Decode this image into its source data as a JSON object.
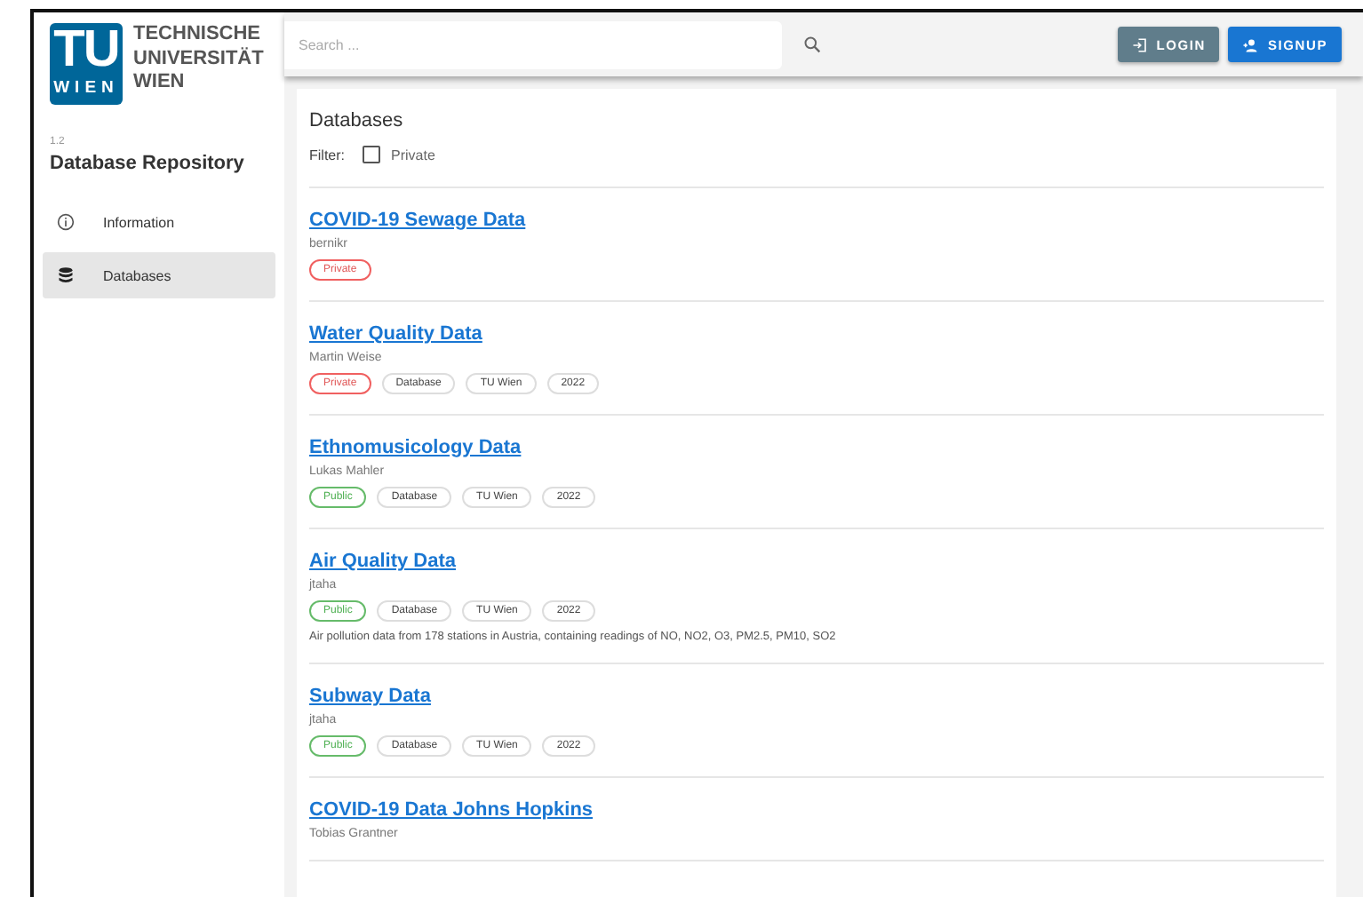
{
  "logo": {
    "mark": "TU",
    "mark_sub": "WIEN",
    "lines": [
      "TECHNISCHE",
      "UNIVERSITÄT",
      "WIEN"
    ]
  },
  "version": "1.2",
  "app_title": "Database Repository",
  "sidebar": {
    "items": [
      {
        "label": "Information",
        "kind": "info",
        "selected": false
      },
      {
        "label": "Databases",
        "kind": "database",
        "selected": true
      }
    ]
  },
  "search": {
    "placeholder": "Search ..."
  },
  "buttons": [
    {
      "label": "LOGIN",
      "kind": "login"
    },
    {
      "label": "SIGNUP",
      "kind": "signup"
    }
  ],
  "page_title": "Databases",
  "filter": {
    "label": "Filter:",
    "option": "Private",
    "checked": false
  },
  "databases": [
    {
      "title": "COVID-19 Sewage Data",
      "author": "bernikr",
      "tags": [
        {
          "label": "Private",
          "kind": "private"
        }
      ]
    },
    {
      "title": "Water Quality Data",
      "author": "Martin Weise",
      "tags": [
        {
          "label": "Private",
          "kind": "private"
        },
        {
          "label": "Database",
          "kind": "plain"
        },
        {
          "label": "TU Wien",
          "kind": "plain"
        },
        {
          "label": "2022",
          "kind": "plain"
        }
      ]
    },
    {
      "title": "Ethnomusicology Data",
      "author": "Lukas Mahler",
      "tags": [
        {
          "label": "Public",
          "kind": "public"
        },
        {
          "label": "Database",
          "kind": "plain"
        },
        {
          "label": "TU Wien",
          "kind": "plain"
        },
        {
          "label": "2022",
          "kind": "plain"
        }
      ]
    },
    {
      "title": "Air Quality Data",
      "author": "jtaha",
      "tags": [
        {
          "label": "Public",
          "kind": "public"
        },
        {
          "label": "Database",
          "kind": "plain"
        },
        {
          "label": "TU Wien",
          "kind": "plain"
        },
        {
          "label": "2022",
          "kind": "plain"
        }
      ],
      "description": "Air pollution data from 178 stations in Austria, containing readings of NO, NO2, O3, PM2.5, PM10, SO2"
    },
    {
      "title": "Subway Data",
      "author": "jtaha",
      "tags": [
        {
          "label": "Public",
          "kind": "public"
        },
        {
          "label": "Database",
          "kind": "plain"
        },
        {
          "label": "TU Wien",
          "kind": "plain"
        },
        {
          "label": "2022",
          "kind": "plain"
        }
      ]
    },
    {
      "title": "COVID-19 Data Johns Hopkins",
      "author": "Tobias Grantner"
    }
  ]
}
